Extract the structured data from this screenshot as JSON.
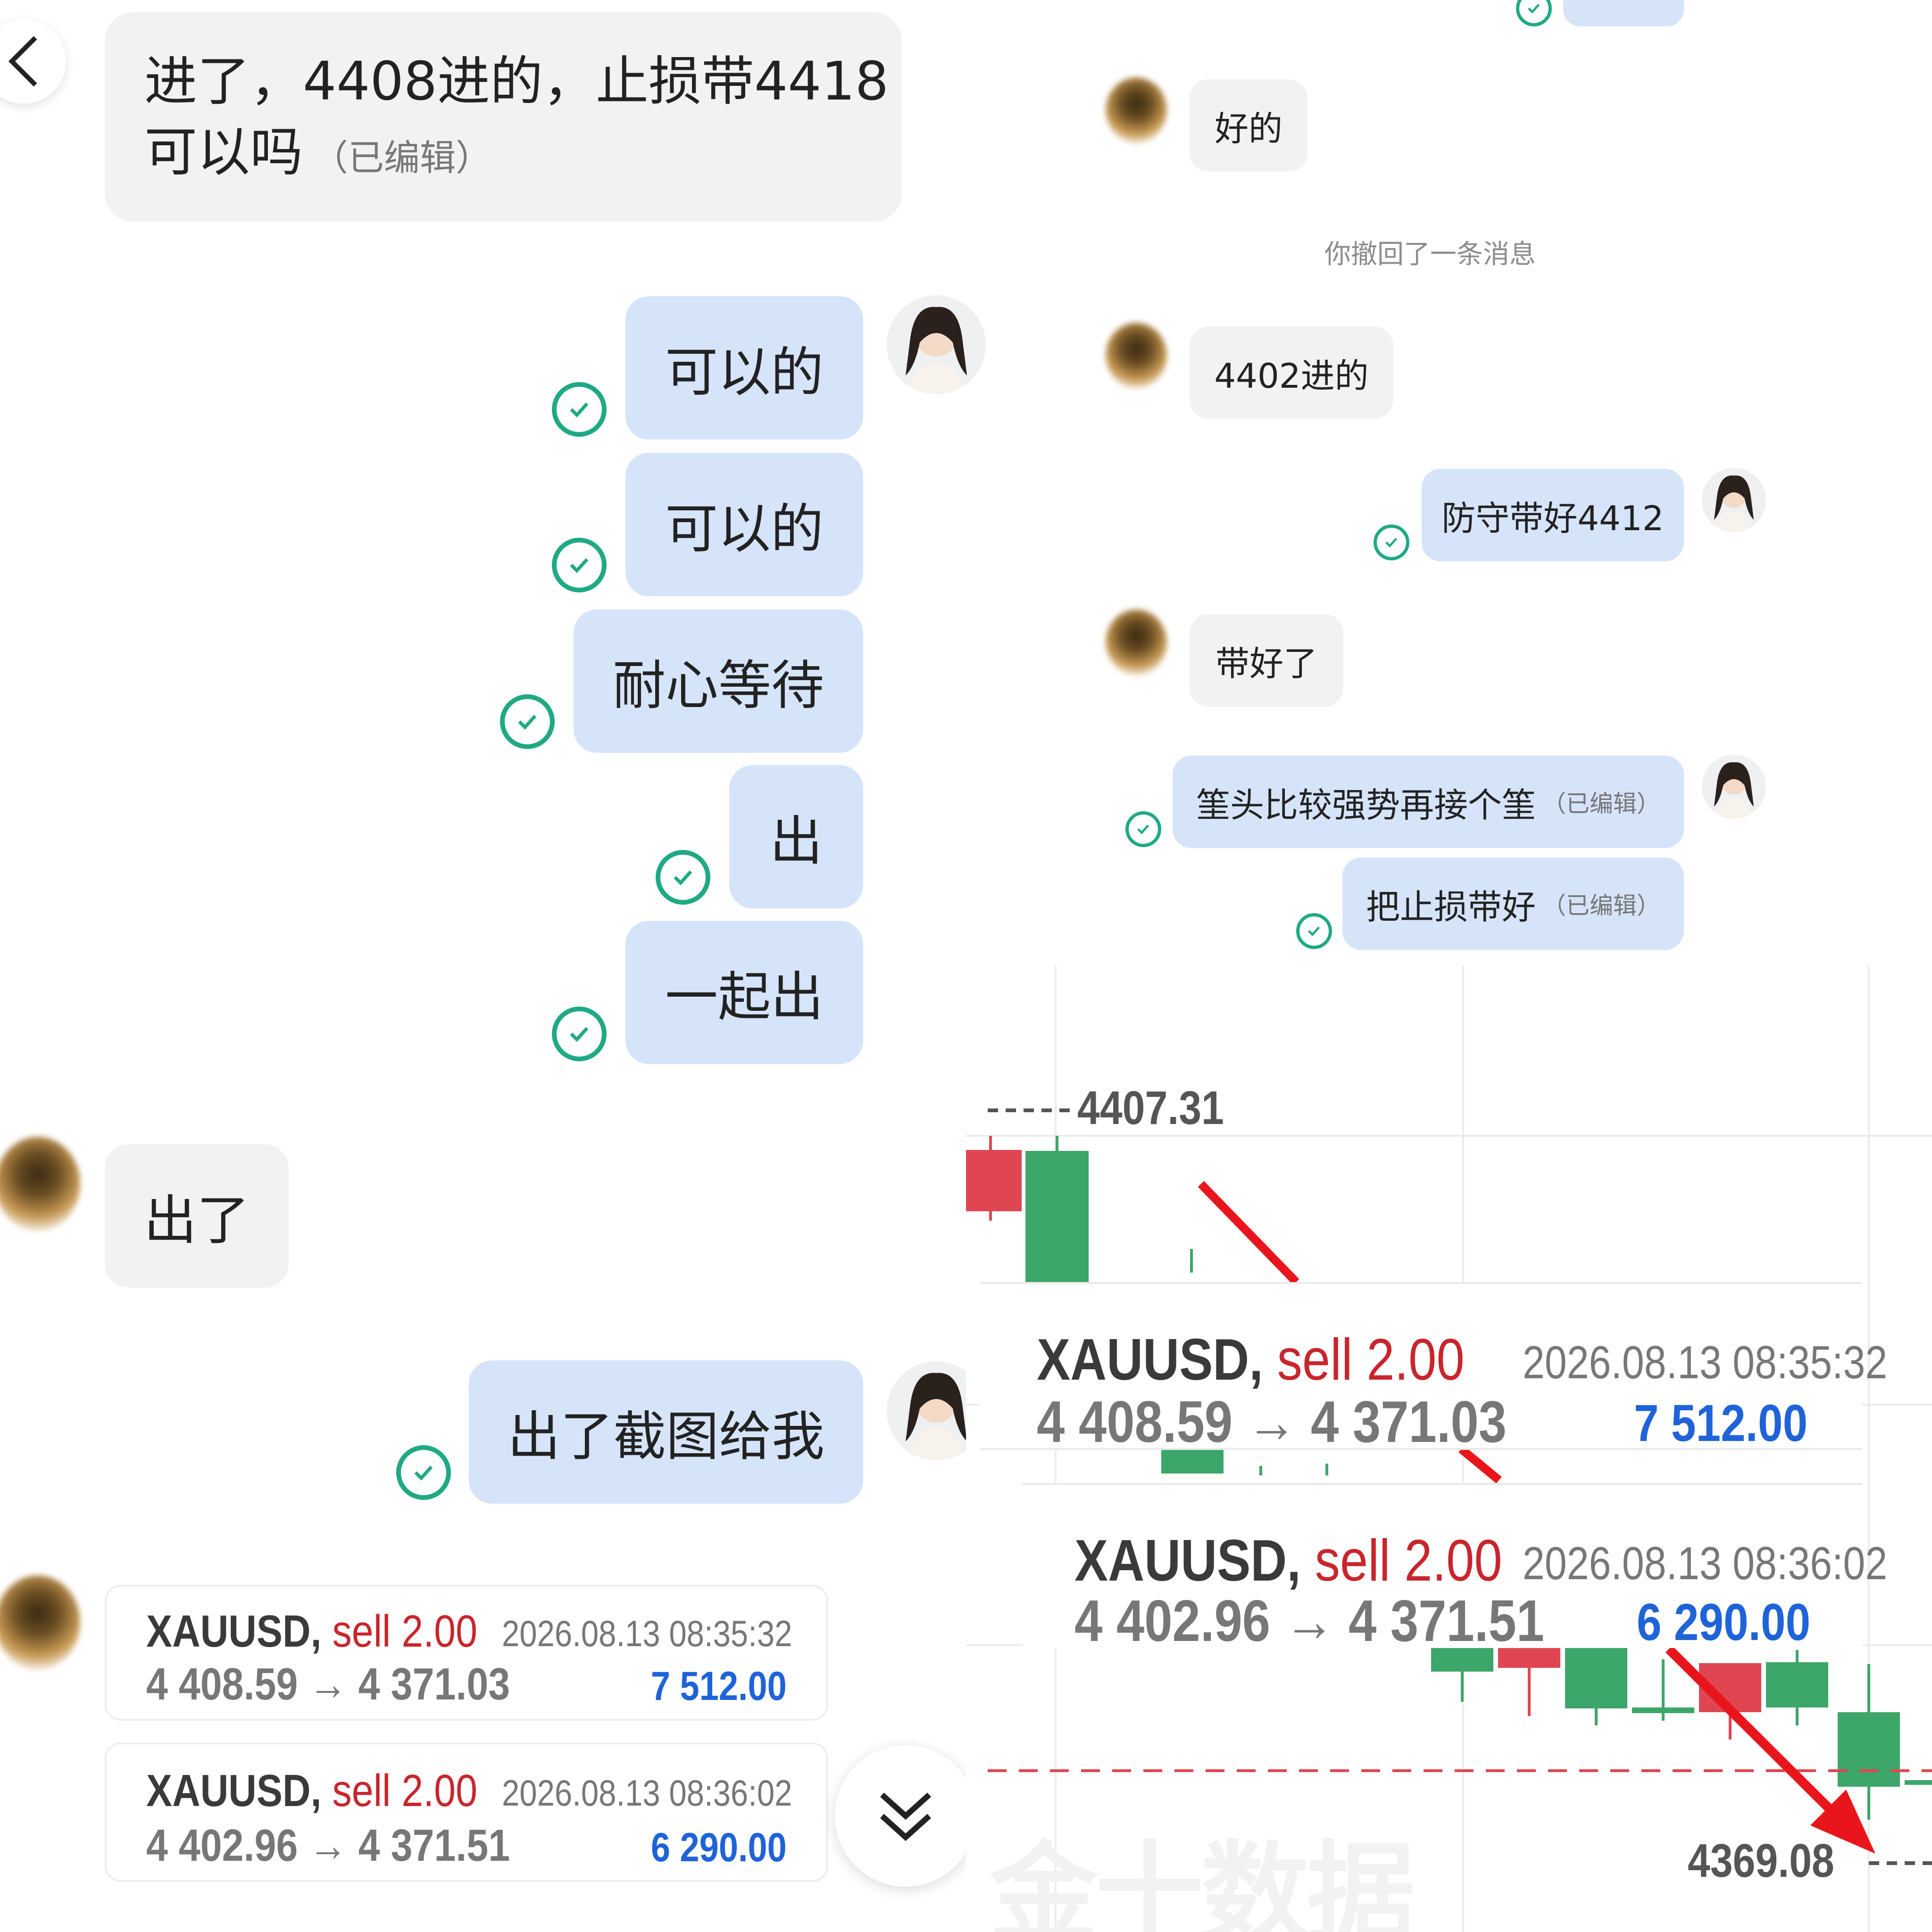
{
  "left_chat": {
    "msg_entered": "进了，4408进的，止损带4418",
    "msg_entered_2": "可以吗",
    "edited_tag": "（已编辑）",
    "reply_1": "可以的",
    "reply_2": "可以的",
    "reply_3": "耐心等待",
    "reply_4": "出",
    "reply_5": "一起出",
    "msg_out": "出了",
    "reply_screenshot": "出了截图给我",
    "scroll_down_icon": "double-chevron-down-icon",
    "back_icon": "chevron-left-icon"
  },
  "right_chat": {
    "msg_ok": "好的",
    "system_recall": "你撤回了一条消息",
    "msg_entry": "4402进的",
    "reply_defend": "防守带好4412",
    "msg_done": "带好了",
    "reply_bulls": "筀头比较强势再接个筀",
    "reply_stoploss": "把止损带好",
    "edited_tag": "（已编辑）"
  },
  "trades": [
    {
      "symbol": "XAUUSD,",
      "side": "sell 2.00",
      "datetime": "2026.08.13 08:35:32",
      "prices": "4 408.59 → 4 371.03",
      "profit": "7 512.00"
    },
    {
      "symbol": "XAUUSD,",
      "side": "sell 2.00",
      "datetime": "2026.08.13 08:36:02",
      "prices": "4 402.96 → 4 371.51",
      "profit": "6 290.00"
    }
  ],
  "chart": {
    "top_price_label": "4407.31",
    "bottom_price_label": "4369.08",
    "watermark": "金十数据",
    "up_color": "#3da66a",
    "down_color": "#e04652",
    "arrow_color": "#e8161c"
  },
  "colors": {
    "outgoing_bubble": "#d6e4fa",
    "incoming_bubble": "#f1f2f4",
    "read_check": "#1fa985",
    "profit_blue": "#1f63d8",
    "sell_red": "#c9252c"
  }
}
